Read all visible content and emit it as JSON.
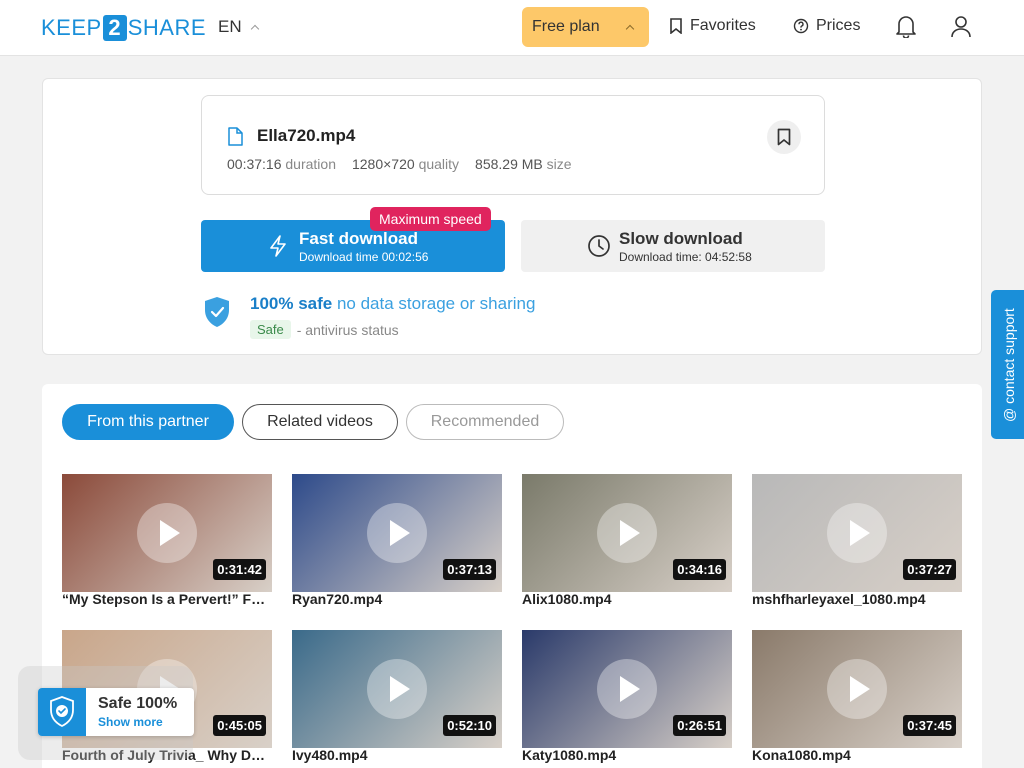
{
  "header": {
    "logo_left": "KEEP",
    "logo_num": "2",
    "logo_right": "SHARE",
    "lang": "EN",
    "plan": "Free plan",
    "favorites": "Favorites",
    "prices": "Prices"
  },
  "file": {
    "name": "Ella720.mp4",
    "duration": "00:37:16",
    "duration_label": "duration",
    "quality": "1280×720",
    "quality_label": "quality",
    "size": "858.29 MB",
    "size_label": "size"
  },
  "fast": {
    "badge": "Maximum speed",
    "title": "Fast download",
    "sub": "Download time 00:02:56"
  },
  "slow": {
    "title": "Slow download",
    "sub": "Download time: 04:52:58"
  },
  "safety": {
    "strong": "100% safe",
    "rest": "no data storage or sharing",
    "tag": "Safe",
    "status": "- antivirus status"
  },
  "tabs": [
    "From this partner",
    "Related videos",
    "Recommended"
  ],
  "videos": [
    {
      "title": "“My Stepson Is a Pervert!” Fuc…",
      "duration": "0:31:42",
      "bg": "#8b4a3a"
    },
    {
      "title": "Ryan720.mp4",
      "duration": "0:37:13",
      "bg": "#2d4a8a"
    },
    {
      "title": "Alix1080.mp4",
      "duration": "0:34:16",
      "bg": "#7a7a6a"
    },
    {
      "title": "mshfharleyaxel_1080.mp4",
      "duration": "0:37:27",
      "bg": "#b8b8b8"
    },
    {
      "title": "Fourth of July Trivia_ Why Do Y…",
      "duration": "0:45:05",
      "bg": "#c9a68a"
    },
    {
      "title": "Ivy480.mp4",
      "duration": "0:52:10",
      "bg": "#3a6a8a"
    },
    {
      "title": "Katy1080.mp4",
      "duration": "0:26:51",
      "bg": "#2a3a6a"
    },
    {
      "title": "Kona1080.mp4",
      "duration": "0:37:45",
      "bg": "#8a7a6a"
    }
  ],
  "support": "@ contact support",
  "badge": {
    "title": "Safe 100%",
    "link": "Show more"
  }
}
